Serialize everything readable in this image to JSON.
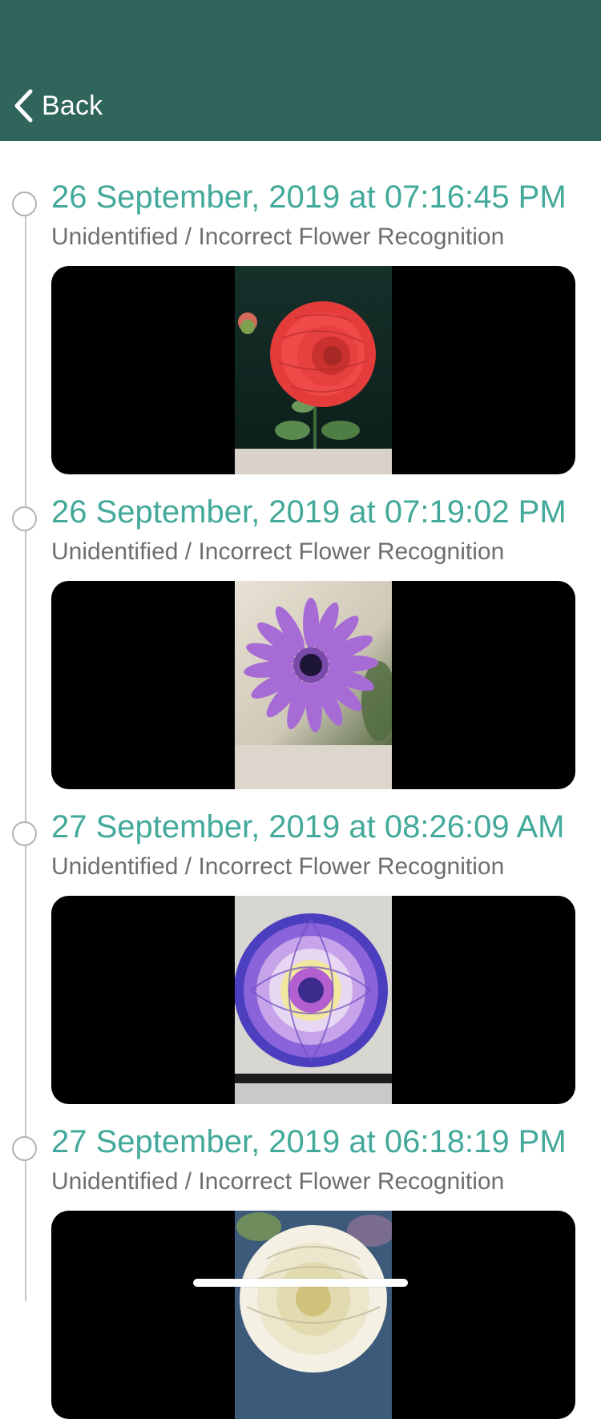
{
  "header": {
    "back_label": "Back",
    "background_color": "#2f655a"
  },
  "accent_color": "#43a99a",
  "entries": [
    {
      "date": "26 September, 2019 at 07:16:45 PM",
      "description": "Unidentified / Incorrect Flower Recognition",
      "photo": "red dahlia"
    },
    {
      "date": "26 September, 2019 at 07:19:02 PM",
      "description": "Unidentified / Incorrect Flower Recognition",
      "photo": "purple daisy"
    },
    {
      "date": "27 September, 2019 at 08:26:09 AM",
      "description": "Unidentified / Incorrect Flower Recognition",
      "photo": "purple and white dahlia"
    },
    {
      "date": "27 September, 2019 at 06:18:19 PM",
      "description": "Unidentified / Incorrect Flower Recognition",
      "photo": "white dahlia"
    }
  ]
}
